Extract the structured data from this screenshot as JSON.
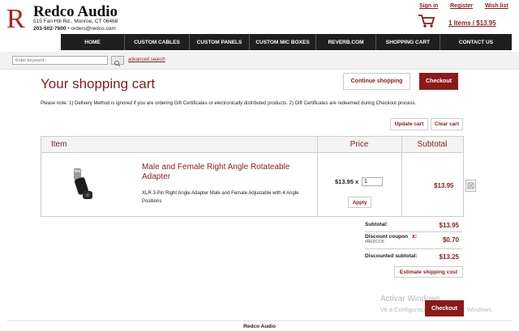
{
  "header": {
    "store_name": "Redco Audio",
    "address": "515 Fan Hill Rd., Monroe, CT 06468",
    "phone": "203-502-7600",
    "email": "orders@redco.com",
    "links": {
      "sign_in": "Sign in",
      "register": "Register",
      "wish_list": "Wish list"
    },
    "cart_summary": "1 Items / $13.95",
    "brand_color": "#8b1a1a"
  },
  "nav": {
    "items": [
      "HOME",
      "CUSTOM CABLES",
      "CUSTOM PANELS",
      "CUSTOM MIC BOXES",
      "REVERB.COM",
      "SHOPPING CART",
      "CONTACT US"
    ]
  },
  "search": {
    "placeholder": "Enter keyword...",
    "advanced_label": "advanced search"
  },
  "cart": {
    "title": "Your shopping cart",
    "continue_label": "Continue shopping",
    "checkout_label": "Checkout",
    "note": "Please note: 1) Delivery Method is ignored if you are ordering Gift Certificates or electronically distributed products. 2) Gift Certificates are redeemed during Checkout process.",
    "update_label": "Update cart",
    "clear_label": "Clear cart",
    "columns": {
      "item": "Item",
      "price": "Price",
      "subtotal": "Subtotal"
    },
    "items": [
      {
        "name": "Male and Female Right Angle Rotateable Adapter",
        "description": "XLR 3-Pin Right Angle Adapter Male and Female Adjustable with 4 Angle Positions",
        "price": "$13.95",
        "times": "x",
        "quantity": "1",
        "apply_label": "Apply",
        "subtotal": "$13.95"
      }
    ],
    "totals": {
      "subtotal_label": "Subtotal:",
      "subtotal_value": "$13.95",
      "coupon_label": "Discount coupon",
      "coupon_remove": "x:",
      "coupon_code": "#REDCO5",
      "coupon_value": "$0.70",
      "discounted_label": "Discounted subtotal:",
      "discounted_value": "$13.25"
    },
    "estimate_label": "Estimate shipping cost",
    "checkout_bottom_label": "Checkout"
  },
  "watermark": {
    "line1": "Activar Windows",
    "line2": "Ve a Configuración para activar Windows."
  },
  "footer": {
    "text": "Redco Audio"
  }
}
